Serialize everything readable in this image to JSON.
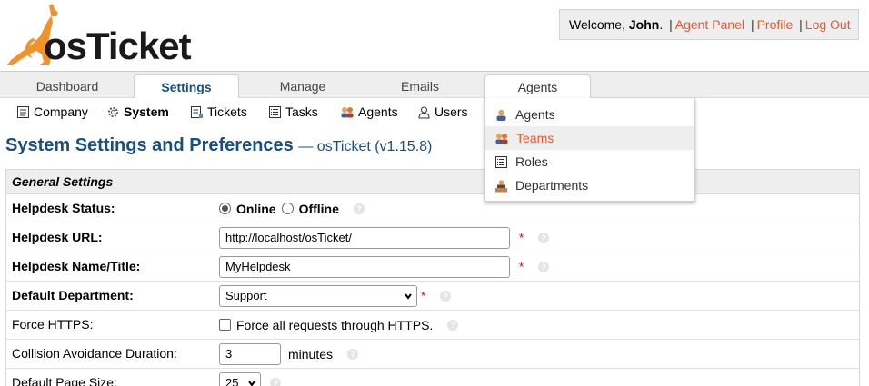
{
  "header": {
    "logo_text": "osTicket",
    "welcome_prefix": "Welcome, ",
    "user_name": "John",
    "welcome_suffix": ".",
    "links": [
      "Agent Panel",
      "Profile",
      "Log Out"
    ],
    "separator": "|"
  },
  "nav": {
    "tabs": [
      {
        "label": "Dashboard"
      },
      {
        "label": "Settings"
      },
      {
        "label": "Manage"
      },
      {
        "label": "Emails"
      },
      {
        "label": "Agents"
      }
    ],
    "active": "Settings",
    "hovered": "Agents"
  },
  "subnav": {
    "items": [
      {
        "label": "Company",
        "icon": "company-icon"
      },
      {
        "label": "System",
        "icon": "gear-icon"
      },
      {
        "label": "Tickets",
        "icon": "ticket-icon"
      },
      {
        "label": "Tasks",
        "icon": "tasks-icon"
      },
      {
        "label": "Agents",
        "icon": "agents-icon"
      },
      {
        "label": "Users",
        "icon": "users-icon"
      }
    ],
    "active": "System"
  },
  "dropdown": {
    "items": [
      {
        "label": "Agents",
        "icon": "agent-icon"
      },
      {
        "label": "Teams",
        "icon": "teams-icon"
      },
      {
        "label": "Roles",
        "icon": "roles-icon"
      },
      {
        "label": "Departments",
        "icon": "departments-icon"
      }
    ],
    "highlighted": "Teams"
  },
  "page": {
    "title": "System Settings and Preferences",
    "subtitle": "— osTicket (v1.15.8)"
  },
  "settings": {
    "section_title": "General Settings",
    "helpdesk_status": {
      "label": "Helpdesk Status:",
      "option_online": "Online",
      "option_offline": "Offline",
      "selected": "Online"
    },
    "helpdesk_url": {
      "label": "Helpdesk URL:",
      "value": "http://localhost/osTicket/"
    },
    "helpdesk_name": {
      "label": "Helpdesk Name/Title:",
      "value": "MyHelpdesk"
    },
    "default_department": {
      "label": "Default Department:",
      "value": "Support"
    },
    "force_https": {
      "label": "Force HTTPS:",
      "checkbox_label": "Force all requests through HTTPS.",
      "checked": false
    },
    "collision": {
      "label": "Collision Avoidance Duration:",
      "value": "3",
      "unit": "minutes"
    },
    "page_size": {
      "label": "Default Page Size:",
      "value": "25"
    },
    "required_marker": "*",
    "help_glyph": "?"
  },
  "colors": {
    "link": "#e35a2c",
    "title": "#184e81",
    "nav_bg": "#eeeeee",
    "required": "#dd0000"
  }
}
